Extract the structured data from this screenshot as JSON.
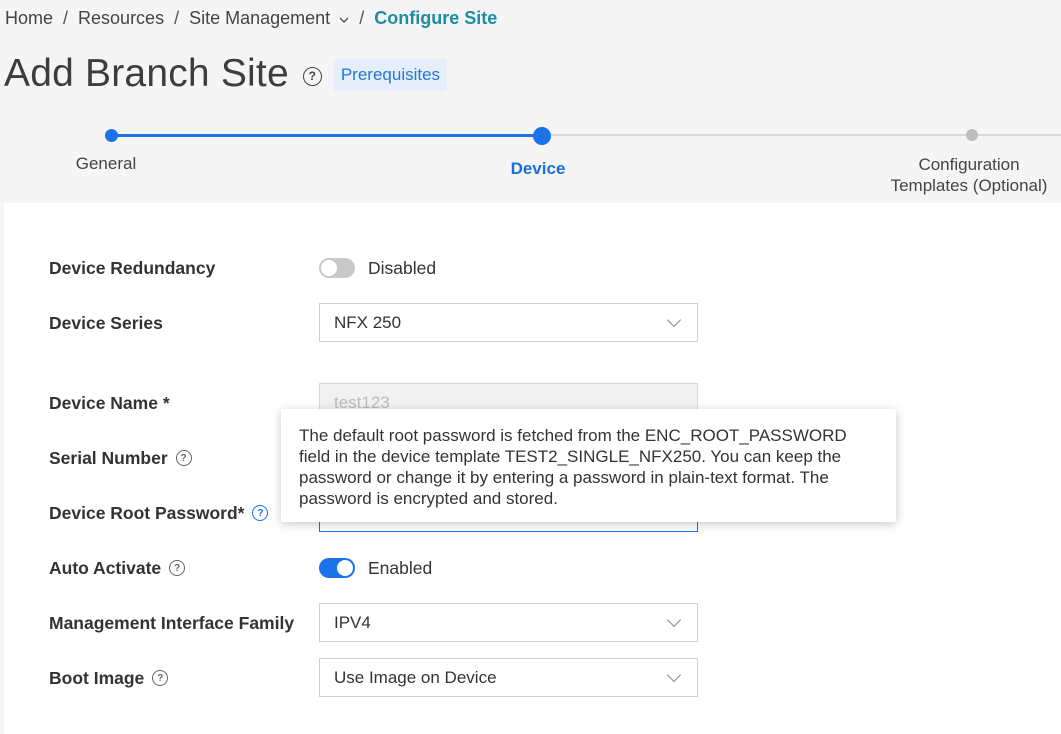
{
  "breadcrumb": {
    "home": "Home",
    "resources": "Resources",
    "site_management": "Site Management",
    "current": "Configure Site",
    "separator": "/"
  },
  "page": {
    "title": "Add Branch Site",
    "prerequisites": "Prerequisites"
  },
  "stepper": {
    "steps": [
      {
        "label": "General",
        "state": "done"
      },
      {
        "label": "Device",
        "state": "current"
      },
      {
        "label_line1": "Configuration",
        "label_line2": "Templates (Optional)",
        "state": "todo"
      }
    ]
  },
  "form": {
    "device_redundancy": {
      "label": "Device Redundancy",
      "value": "Disabled",
      "on": false
    },
    "device_series": {
      "label": "Device Series",
      "value": "NFX 250"
    },
    "device_name": {
      "label": "Device Name *",
      "value": "test123"
    },
    "serial_number": {
      "label": "Serial Number"
    },
    "device_root_password": {
      "label": "Device Root Password*"
    },
    "auto_activate": {
      "label": "Auto Activate",
      "value": "Enabled",
      "on": true
    },
    "management_interface_family": {
      "label": "Management Interface Family",
      "value": "IPV4"
    },
    "boot_image": {
      "label": "Boot Image",
      "value": "Use Image on Device"
    }
  },
  "tooltip": {
    "text": "The default root password is fetched from the ENC_ROOT_PASSWORD field in the device template TEST2_SINGLE_NFX250. You can keep the password or change it by entering a password in plain-text format. The password is encrypted and stored."
  },
  "colors": {
    "accent": "#1a73e8",
    "breadcrumb_current": "#1b8ea3",
    "prereq_bg": "#e6eefb"
  }
}
